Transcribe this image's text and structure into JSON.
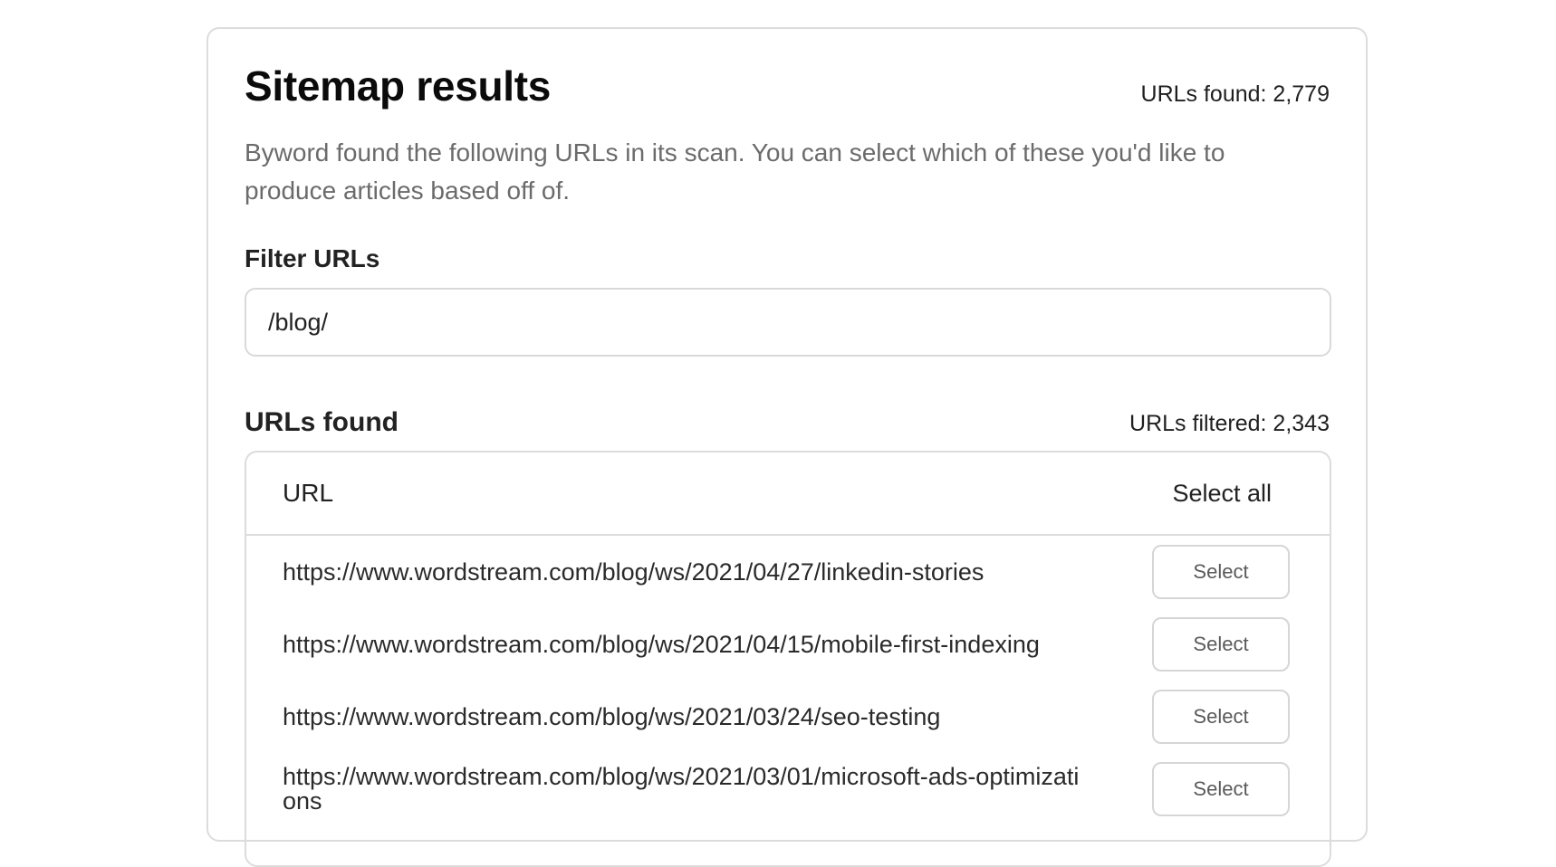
{
  "header": {
    "title": "Sitemap results",
    "urls_found_count": "URLs found: 2,779",
    "description": "Byword found the following URLs in its scan. You can select which of these you'd like to produce articles based off of."
  },
  "filter": {
    "label": "Filter URLs",
    "value": "/blog/"
  },
  "results": {
    "label": "URLs found",
    "filtered_count": "URLs filtered: 2,343",
    "table": {
      "col_url": "URL",
      "select_all": "Select all",
      "rows": [
        {
          "url": "https://www.wordstream.com/blog/ws/2021/04/27/linkedin-stories",
          "button": "Select"
        },
        {
          "url": "https://www.wordstream.com/blog/ws/2021/04/15/mobile-first-indexing",
          "button": "Select"
        },
        {
          "url": "https://www.wordstream.com/blog/ws/2021/03/24/seo-testing",
          "button": "Select"
        },
        {
          "url": "https://www.wordstream.com/blog/ws/2021/03/01/microsoft-ads-optimizations",
          "button": "Select"
        }
      ]
    }
  }
}
